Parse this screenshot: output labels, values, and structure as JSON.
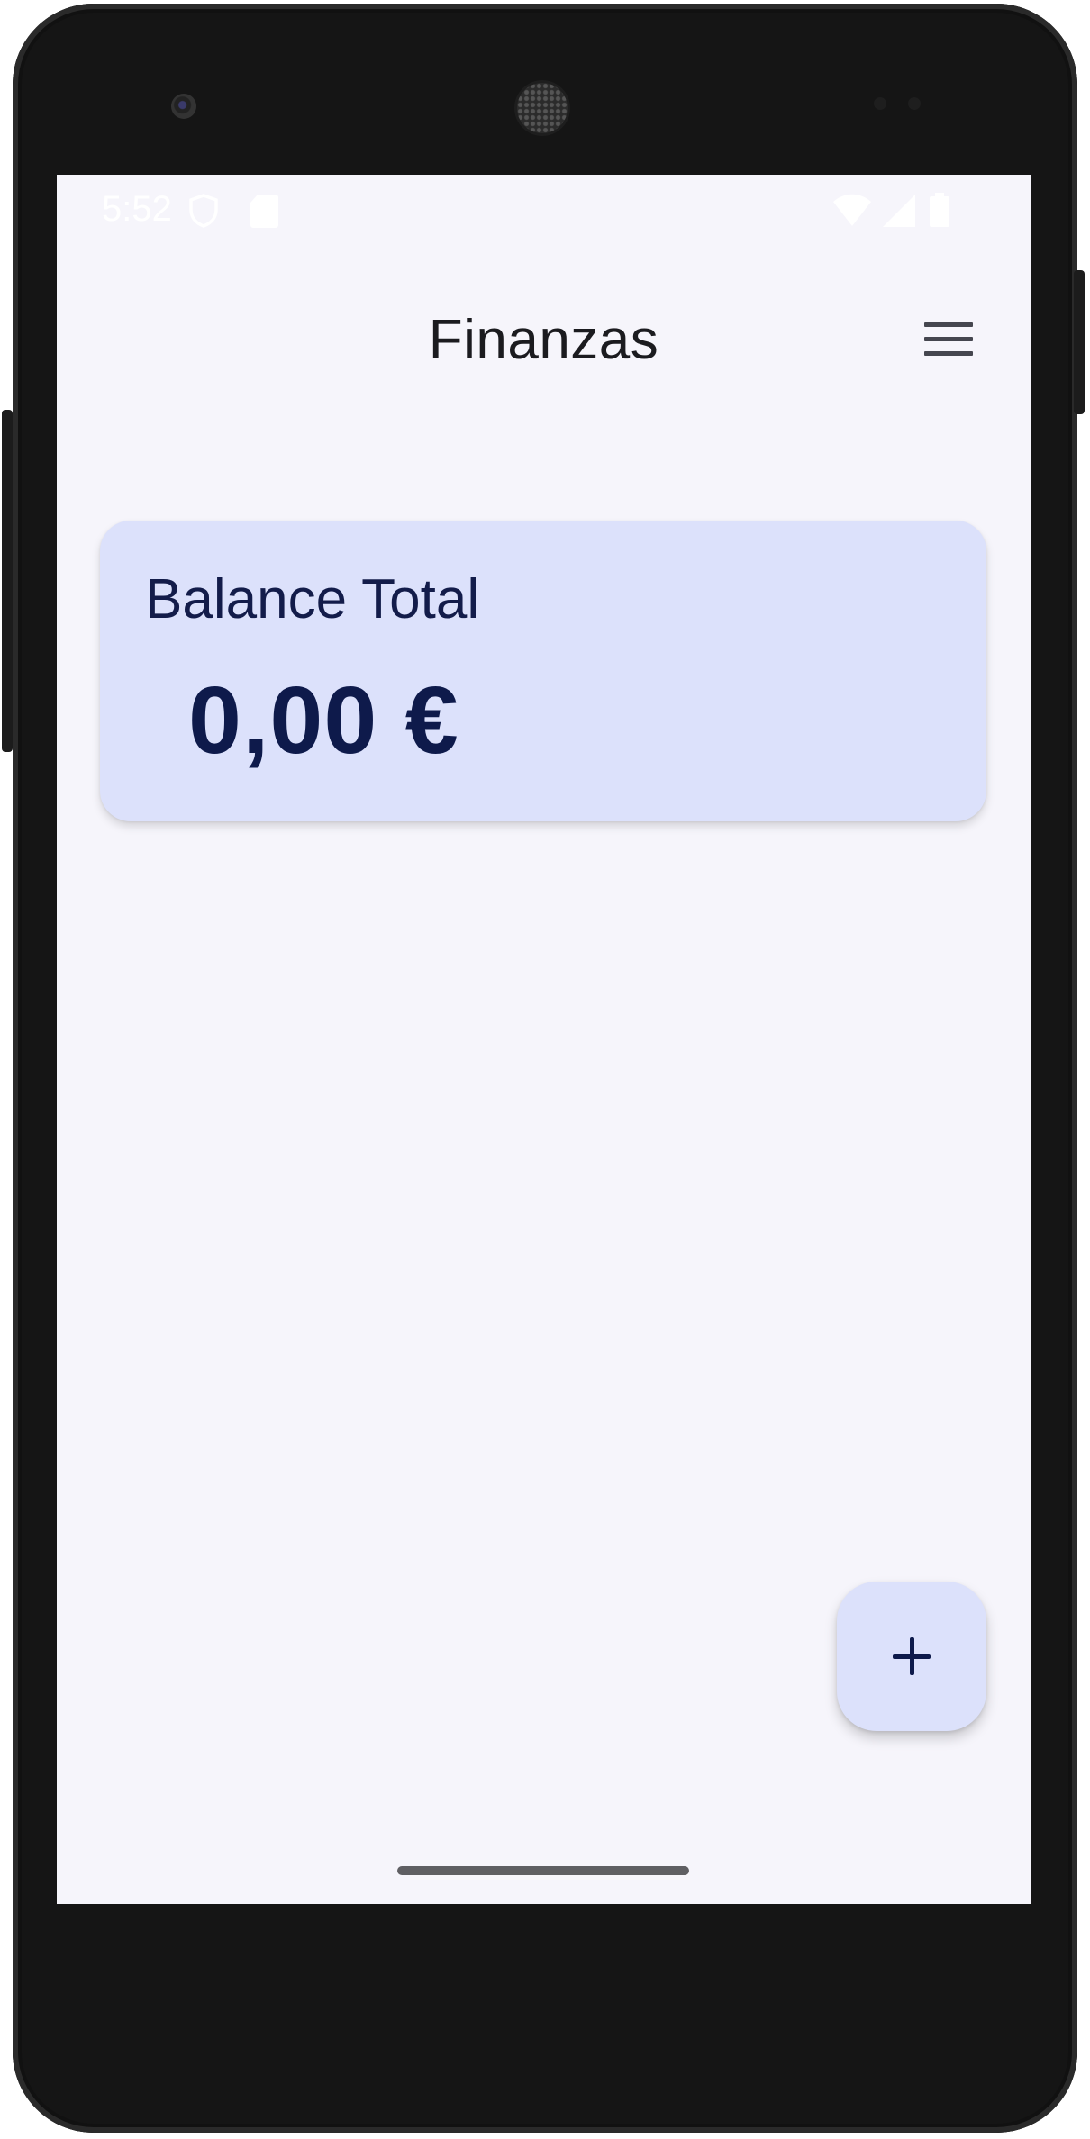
{
  "status_bar": {
    "time": "5:52",
    "icons": [
      "shield-icon",
      "sd-card-icon",
      "wifi-icon",
      "cell-signal-icon",
      "battery-icon"
    ]
  },
  "app_bar": {
    "title": "Finanzas",
    "menu_icon": "hamburger-menu-icon"
  },
  "balance_card": {
    "label": "Balance Total",
    "amount": "0,00 €"
  },
  "fab": {
    "icon": "plus-icon"
  },
  "colors": {
    "screen_background": "#f6f5fb",
    "card_background": "#dce1fb",
    "primary_text": "#0e1a4b",
    "title_text": "#1b1b1f"
  }
}
